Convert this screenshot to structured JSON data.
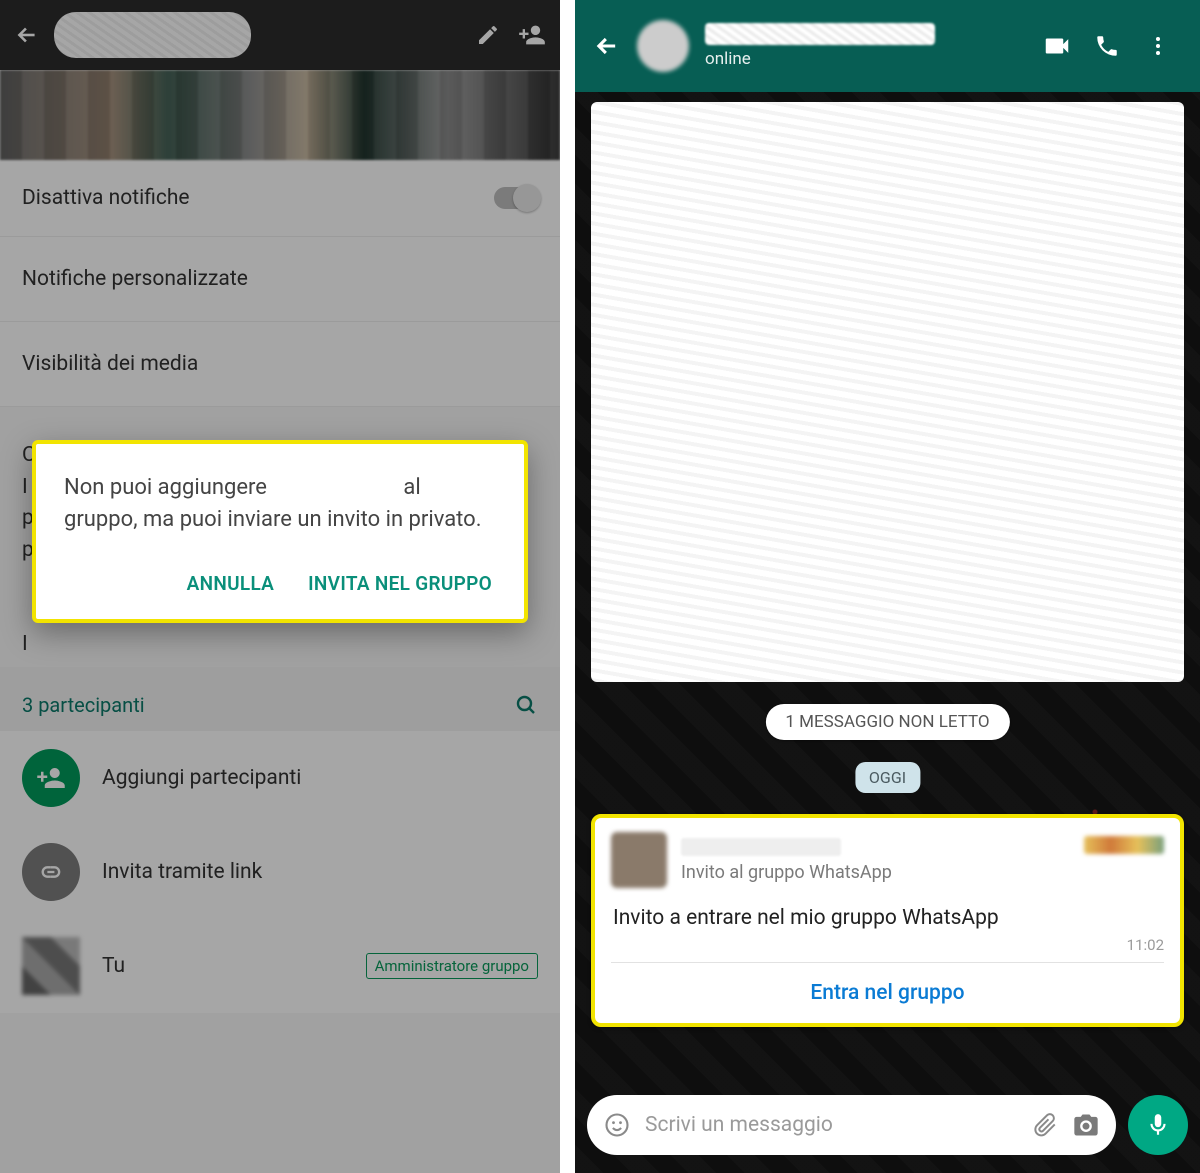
{
  "left": {
    "settings": {
      "mute": "Disattiva notifiche",
      "custom_notif": "Notifiche personalizzate",
      "media_vis": "Visibilità dei media"
    },
    "dialog": {
      "text_a": "Non puoi aggiungere",
      "text_b": "al gruppo, ma puoi inviare un invito in privato.",
      "cancel": "ANNULLA",
      "invite": "INVITA NEL GRUPPO"
    },
    "participants": {
      "title": "3 partecipanti",
      "add": "Aggiungi partecipanti",
      "link": "Invita tramite link",
      "you": "Tu",
      "admin_badge": "Amministratore gruppo"
    }
  },
  "right": {
    "header": {
      "status": "online"
    },
    "unread_pill": "1 MESSAGGIO NON LETTO",
    "day_pill": "OGGI",
    "msg": {
      "subtitle": "Invito al gruppo WhatsApp",
      "body": "Invito a entrare nel mio gruppo WhatsApp",
      "time": "11:02",
      "action": "Entra nel gruppo"
    },
    "composer": {
      "placeholder": "Scrivi un messaggio"
    }
  }
}
